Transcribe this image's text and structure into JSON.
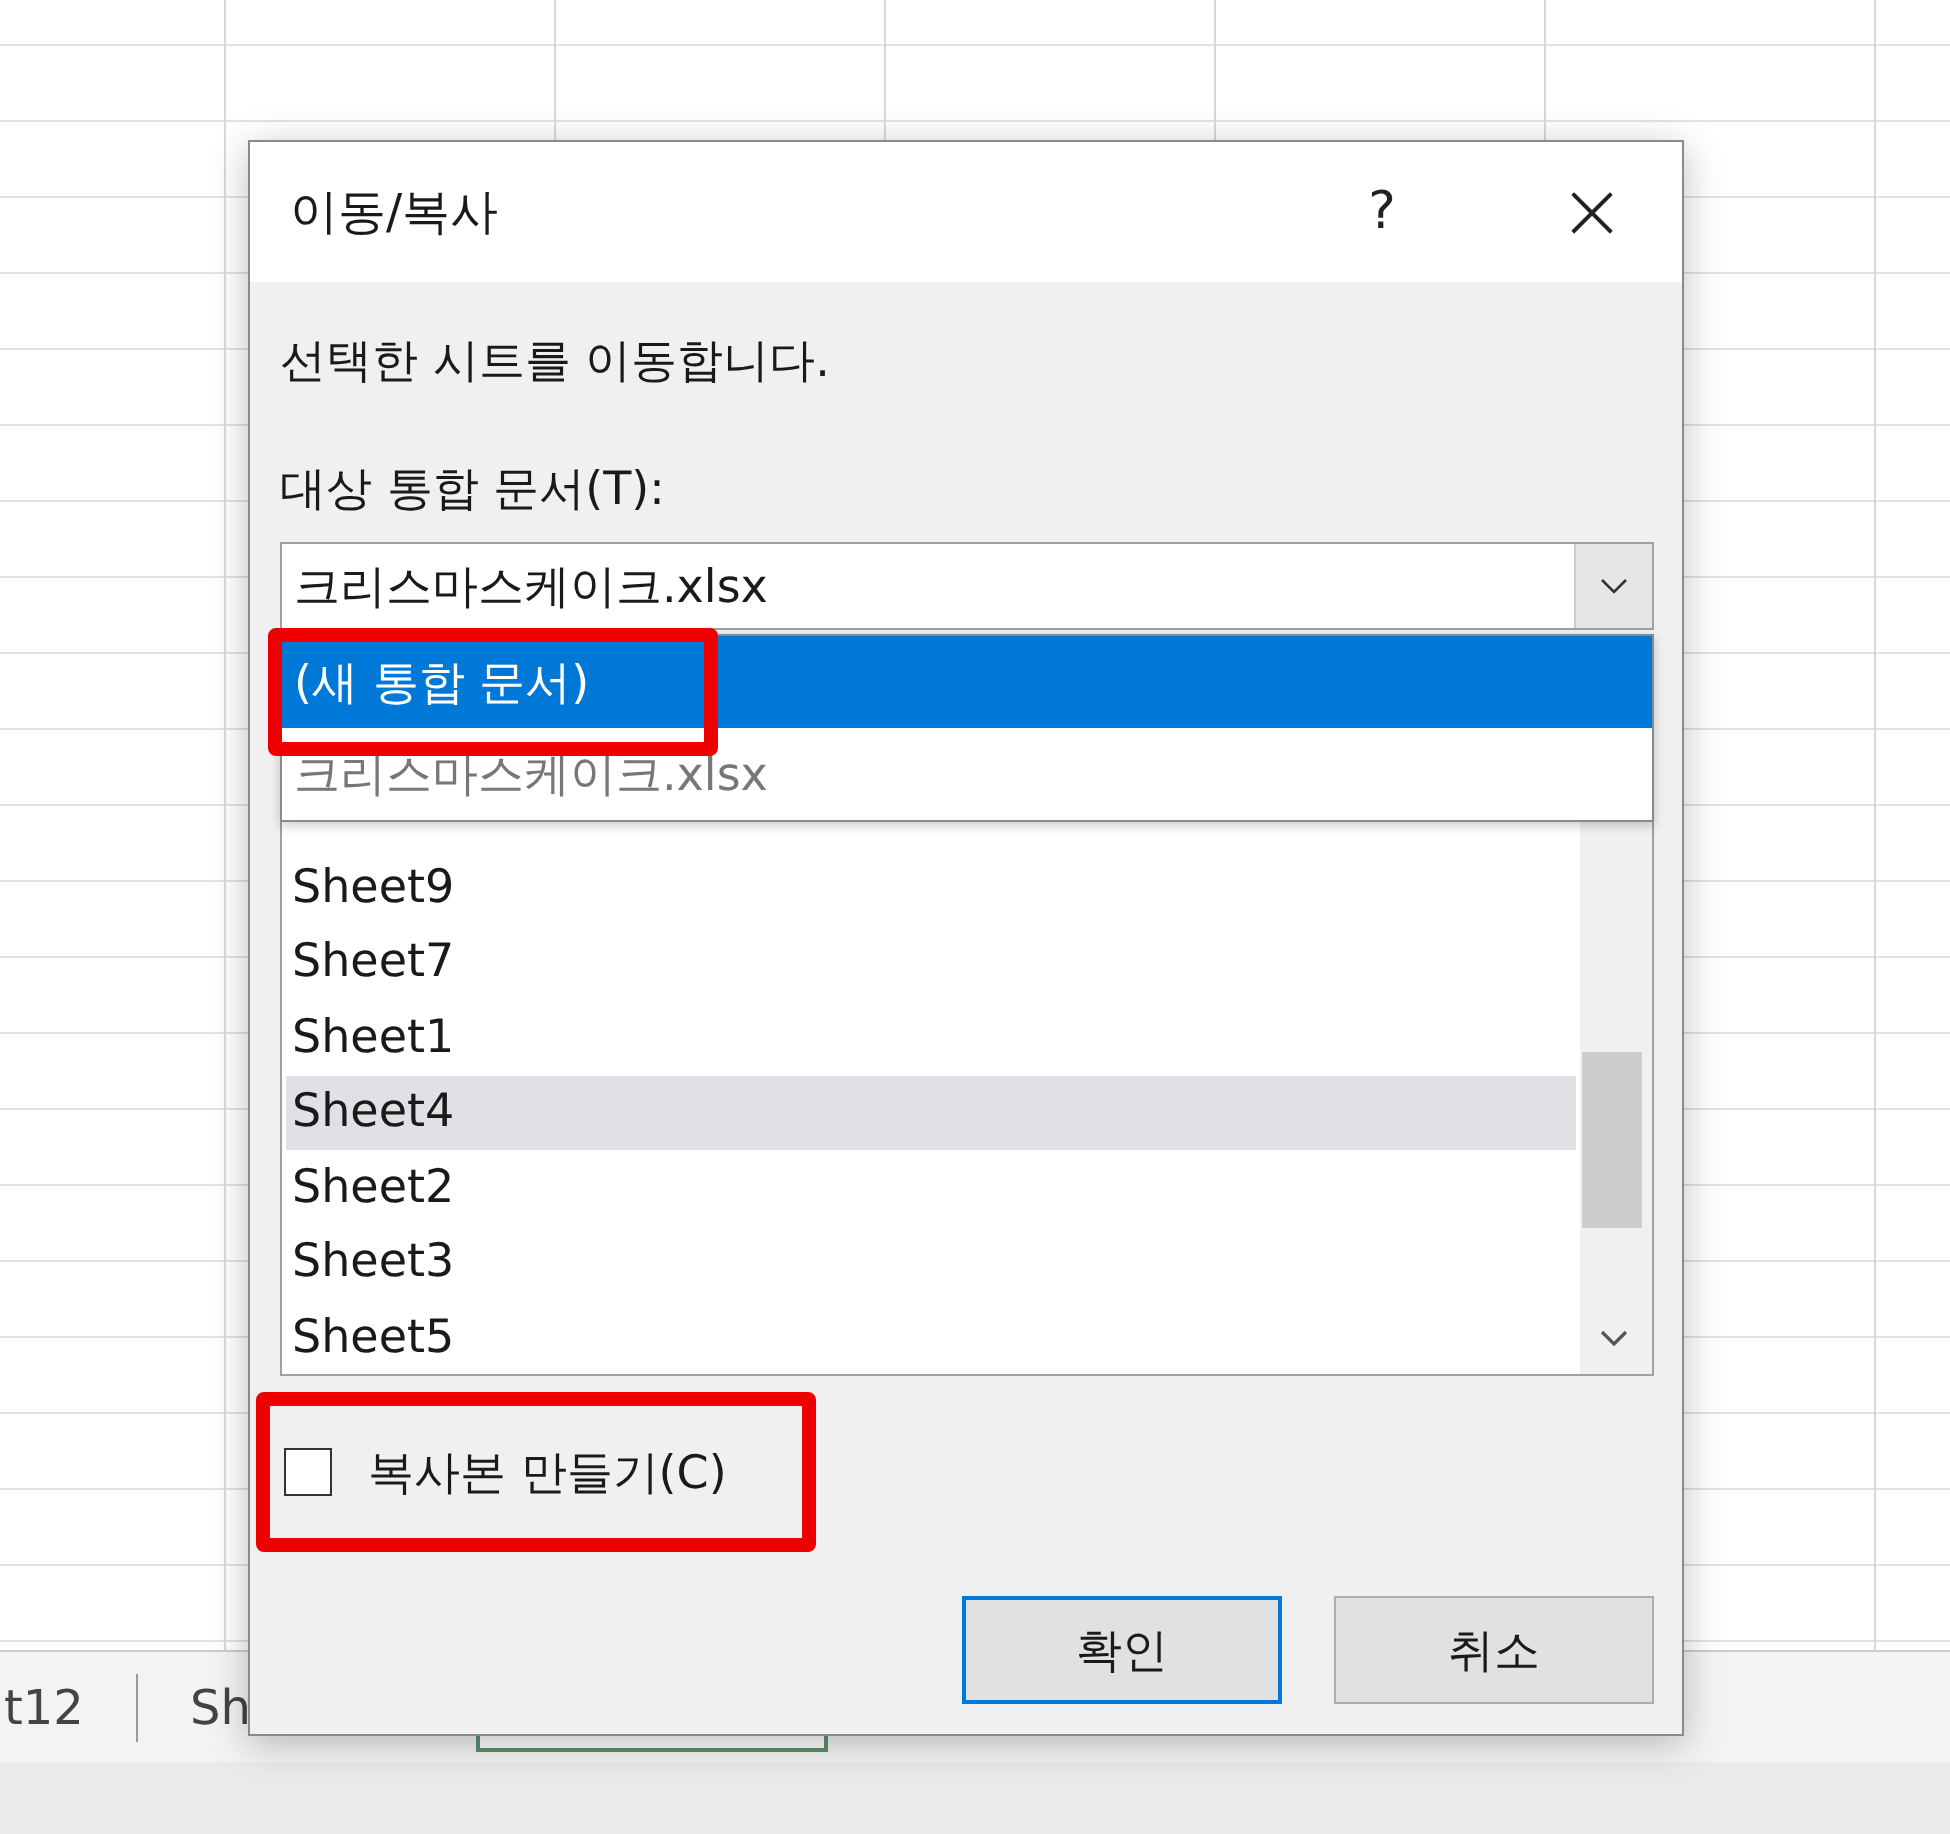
{
  "dialog": {
    "title": "이동/복사",
    "help": "?",
    "close": "×",
    "message": "선택한 시트를 이동합니다.",
    "target_label": "대상 통합 문서(T):",
    "target_value": "크리스마스케이크.xlsx",
    "dropdown_options": [
      {
        "label": "(새 통합 문서)",
        "selected": true,
        "annotated": true
      },
      {
        "label": "크리스마스케이크.xlsx",
        "selected": false,
        "annotated": false
      }
    ],
    "sheets": [
      {
        "label": "Sheet9",
        "selected": false
      },
      {
        "label": "Sheet7",
        "selected": false
      },
      {
        "label": "Sheet1",
        "selected": false
      },
      {
        "label": "Sheet4",
        "selected": true
      },
      {
        "label": "Sheet2",
        "selected": false
      },
      {
        "label": "Sheet3",
        "selected": false
      },
      {
        "label": "Sheet5",
        "selected": false
      }
    ],
    "copy_checkbox": {
      "label": "복사본 만들기(C)",
      "checked": false,
      "annotated": true
    },
    "buttons": [
      {
        "label": "확인",
        "kind": "default"
      },
      {
        "label": "취소",
        "kind": "normal"
      }
    ]
  },
  "sheet_tabs": [
    "t12",
    "Sh"
  ]
}
